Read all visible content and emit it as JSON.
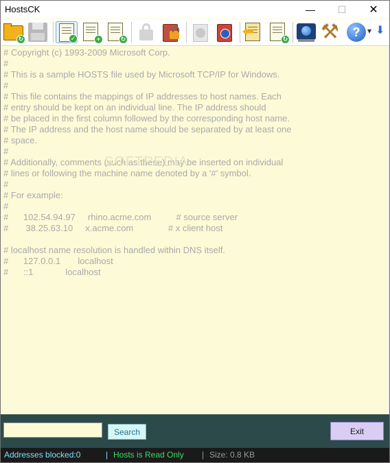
{
  "window": {
    "title": "HostsCK",
    "minimize": "—",
    "maximize": "☐",
    "close": "✕"
  },
  "toolbar": {
    "help_dropdown": "▾",
    "download": "⬇",
    "help": "?",
    "tools": "⚒"
  },
  "editor": {
    "text": "# Copyright (c) 1993-2009 Microsoft Corp.\n#\n# This is a sample HOSTS file used by Microsoft TCP/IP for Windows.\n#\n# This file contains the mappings of IP addresses to host names. Each\n# entry should be kept on an individual line. The IP address should\n# be placed in the first column followed by the corresponding host name.\n# The IP address and the host name should be separated by at least one\n# space.\n#\n# Additionally, comments (such as these) may be inserted on individual\n# lines or following the machine name denoted by a '#' symbol.\n#\n# For example:\n#\n#      102.54.94.97     rhino.acme.com          # source server\n#       38.25.63.10     x.acme.com              # x client host\n\n# localhost name resolution is handled within DNS itself.\n#\t127.0.0.1       localhost\n#\t::1             localhost",
    "watermark": "SOFTPEDIA"
  },
  "search": {
    "value": "",
    "placeholder": "",
    "button_label": "Search"
  },
  "exit_label": "Exit",
  "status": {
    "blocked": "Addresses blocked:0",
    "sep1": "|",
    "readonly": "Hosts is Read Only",
    "sep2": "|",
    "size": "Size: 0.8 KB"
  },
  "colors": {
    "editor_bg": "#fdfbd7",
    "bottom_panel": "#2d4a4b",
    "status_blocked": "#7fe0ff",
    "status_readonly": "#3ddc6a",
    "status_size": "#9a9a9a"
  }
}
